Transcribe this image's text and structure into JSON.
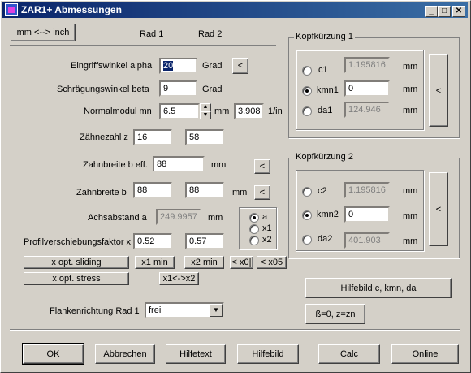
{
  "window": {
    "title": "ZAR1+ Abmessungen",
    "min": "_",
    "max": "□",
    "close": "✕"
  },
  "header": {
    "unit_button": "mm <--> inch",
    "rad1": "Rad 1",
    "rad2": "Rad 2"
  },
  "rows": {
    "eingriff": {
      "label": "Eingriffswinkel alpha",
      "value": "20",
      "unit": "Grad",
      "btn": "<"
    },
    "schraeg": {
      "label": "Schrägungswinkel beta",
      "value": "9",
      "unit": "Grad"
    },
    "normal": {
      "label": "Normalmodul mn",
      "value": "6.5",
      "unit": "mm",
      "value2": "3.908",
      "unit2": "1/in"
    },
    "zaehne": {
      "label": "Zähnezahl z",
      "v1": "16",
      "v2": "58"
    },
    "bbreite": {
      "label": "Zahnbreite b eff.",
      "value": "88",
      "unit": "mm",
      "btn": "<"
    },
    "breite": {
      "label": "Zahnbreite b",
      "v1": "88",
      "v2": "88",
      "unit": "mm",
      "btn": "<"
    },
    "achs": {
      "label": "Achsabstand a",
      "value": "249.9957",
      "unit": "mm"
    },
    "profil": {
      "label": "Profilverschiebungsfaktor x",
      "v1": "0.52",
      "v2": "0.57"
    }
  },
  "radio_group": {
    "a": "a",
    "x1": "x1",
    "x2": "x2"
  },
  "buttons": {
    "xopt_sliding": "x opt. sliding",
    "xopt_stress": "x opt. stress",
    "x1min": "x1 min",
    "x2min": "x2 min",
    "x0": "< x0|",
    "x05": "< x05",
    "x1x2": "x1<->x2",
    "hilfebild_c": "Hilfebild c, kmn, da",
    "beta0": "ß=0, z=zn"
  },
  "flanke": {
    "label": "Flankenrichtung Rad 1",
    "value": "frei"
  },
  "kopf1": {
    "title": "Kopfkürzung 1",
    "c1": "c1",
    "c1_val": "1.195816",
    "kmn1": "kmn1",
    "kmn1_val": "0",
    "da1": "da1",
    "da1_val": "124.946",
    "unit": "mm",
    "btn": "<"
  },
  "kopf2": {
    "title": "Kopfkürzung 2",
    "c2": "c2",
    "c2_val": "1.195816",
    "kmn2": "kmn2",
    "kmn2_val": "0",
    "da2": "da2",
    "da2_val": "401.903",
    "unit": "mm",
    "btn": "<"
  },
  "footer": {
    "ok": "OK",
    "abbrechen": "Abbrechen",
    "hilfetext": "Hilfetext",
    "hilfebild": "Hilfebild",
    "calc": "Calc",
    "online": "Online"
  }
}
